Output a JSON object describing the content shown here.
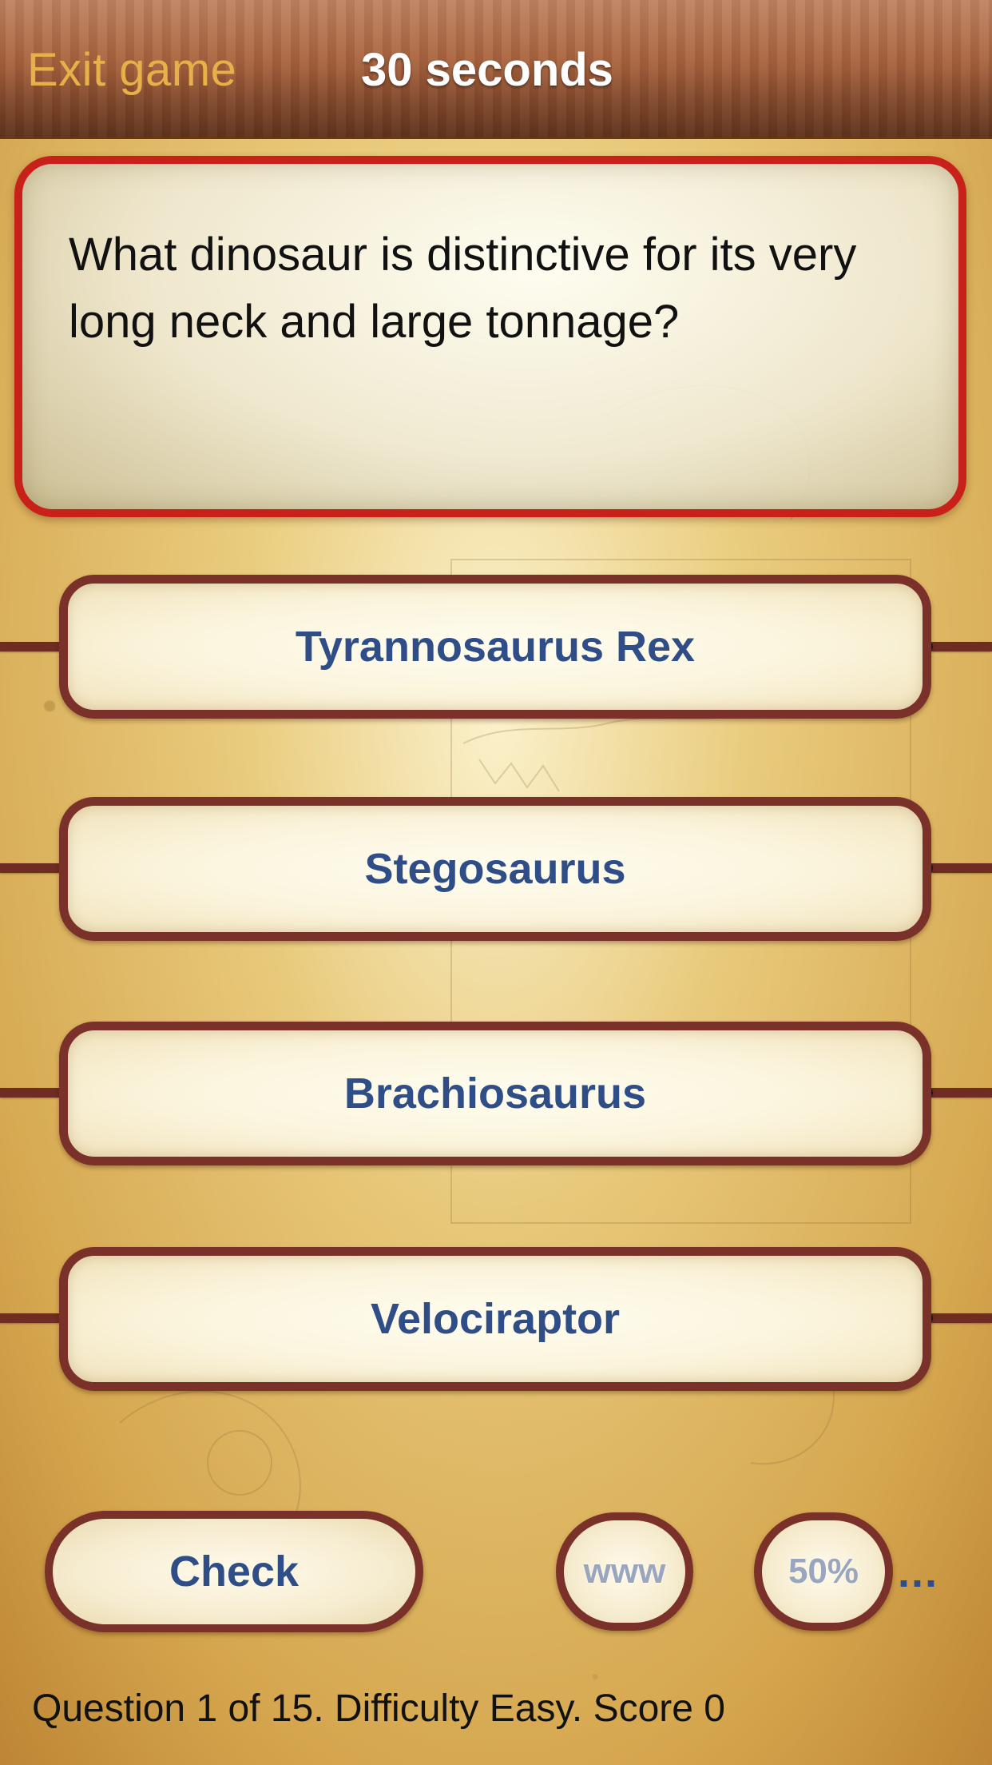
{
  "header": {
    "exit_label": "Exit game",
    "timer_label": "30 seconds"
  },
  "question": {
    "text": "What dinosaur is distinctive for its very long neck and large tonnage?"
  },
  "answers": [
    {
      "label": "Tyrannosaurus Rex"
    },
    {
      "label": "Stegosaurus"
    },
    {
      "label": "Brachiosaurus"
    },
    {
      "label": "Velociraptor"
    }
  ],
  "controls": {
    "check_label": "Check",
    "www_label": "www",
    "fifty_label": "50%",
    "more_label": "..."
  },
  "status": {
    "text": "Question 1 of 15. Difficulty Easy. Score 0"
  },
  "colors": {
    "answer_text": "#2f4d86",
    "question_border": "#c8211a",
    "answer_border": "#7a3129",
    "exit_link": "#e8b048"
  }
}
